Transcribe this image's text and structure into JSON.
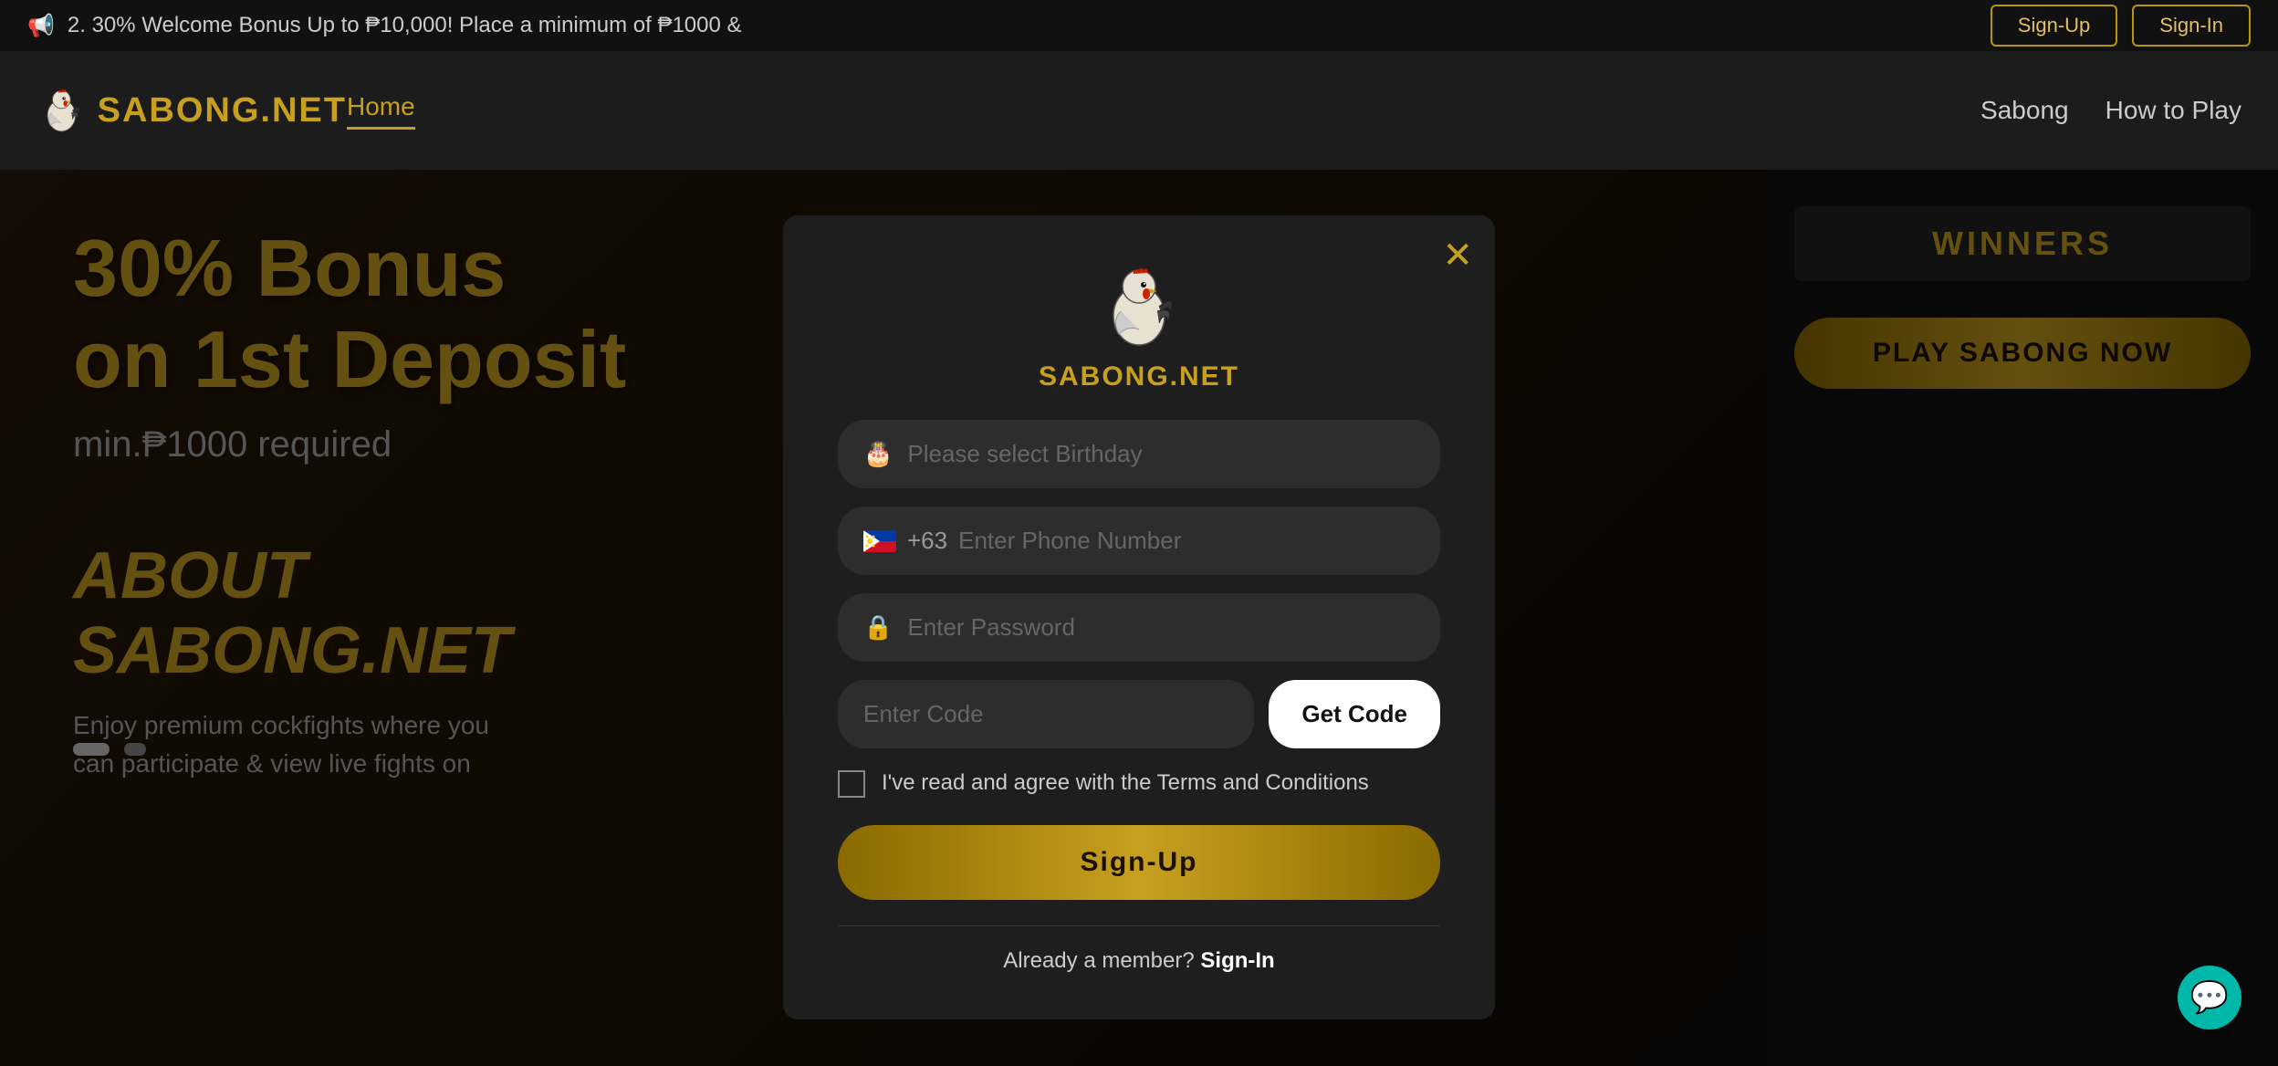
{
  "announcement": {
    "text": "2. 30% Welcome Bonus Up to ₱10,000! Place a minimum of ₱1000 &",
    "signup_label": "Sign-Up",
    "signin_label": "Sign-In"
  },
  "header": {
    "logo_text": "SABONG.NET",
    "nav": {
      "home": "Home",
      "sabong": "Sabong",
      "how_to_play": "How to Play"
    }
  },
  "banner": {
    "line1": "30% Bonus",
    "line2": "on 1st Deposit",
    "min_text": "min.₱1000 required",
    "about_title": "ABOUT\nSABONG.NET",
    "about_desc": "Enjoy premium cockfights where you\ncan participate & view live fights on"
  },
  "winners": {
    "header": "WINNERS",
    "play_btn": "PLAY SABONG NOW"
  },
  "modal": {
    "logo_text": "SABONG.NET",
    "close_icon": "✕",
    "birthday_placeholder": "Please select Birthday",
    "phone_prefix": "+63",
    "phone_placeholder": "Enter Phone Number",
    "password_placeholder": "Enter Password",
    "code_placeholder": "Enter Code",
    "get_code_label": "Get Code",
    "terms_text": "I've read and agree with the Terms and Conditions",
    "signup_label": "Sign-Up",
    "already_text": "Already a member?",
    "signin_label": "Sign-In"
  },
  "chat": {
    "icon": "💬"
  }
}
